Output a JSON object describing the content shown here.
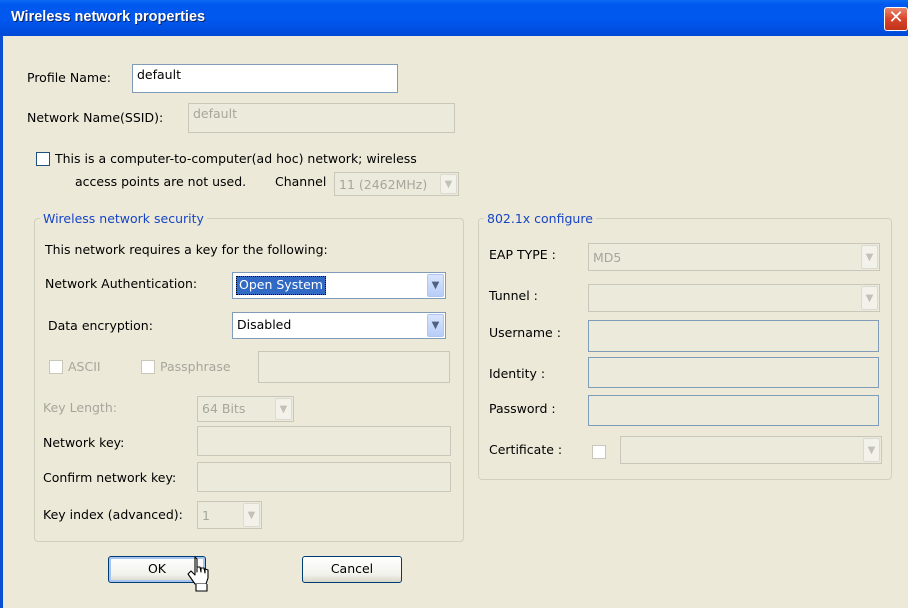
{
  "window": {
    "title": "Wireless network properties",
    "close_symbol": "✕"
  },
  "profile": {
    "label": "Profile Name:",
    "value": "default"
  },
  "ssid": {
    "label": "Network Name(SSID):",
    "value": "default"
  },
  "adhoc": {
    "line1": "This is a computer-to-computer(ad hoc) network; wireless",
    "line2": "access points are not used.",
    "channel_label": "Channel",
    "channel_value": "11 (2462MHz)",
    "checked": false
  },
  "security": {
    "group_title": "Wireless network security",
    "intro": "This network requires a key for the following:",
    "auth_label": "Network Authentication:",
    "auth_value": "Open System",
    "enc_label": "Data encryption:",
    "enc_value": "Disabled",
    "ascii_label": "ASCII",
    "passphrase_label": "Passphrase",
    "passphrase_value": "",
    "key_length_label": "Key Length:",
    "key_length_value": "64 Bits",
    "network_key_label": "Network key:",
    "network_key_value": "",
    "confirm_key_label": "Confirm network key:",
    "confirm_key_value": "",
    "key_index_label": "Key index (advanced):",
    "key_index_value": "1"
  },
  "dot1x": {
    "group_title": "802.1x configure",
    "eap_label": "EAP TYPE :",
    "eap_value": "MD5",
    "tunnel_label": "Tunnel :",
    "tunnel_value": "",
    "username_label": "Username :",
    "username_value": "",
    "identity_label": "Identity :",
    "identity_value": "",
    "password_label": "Password :",
    "password_value": "",
    "certificate_label": "Certificate :",
    "certificate_value": ""
  },
  "buttons": {
    "ok": "OK",
    "cancel": "Cancel"
  },
  "icons": {
    "dropdown": "chevron-down-icon",
    "close": "close-icon",
    "cursor": "mouse-pointer-icon"
  },
  "colors": {
    "titlebar": "#0058ee",
    "group_title": "#1645c6",
    "dialog_bg": "#ece9d8",
    "selection": "#316ac5"
  }
}
